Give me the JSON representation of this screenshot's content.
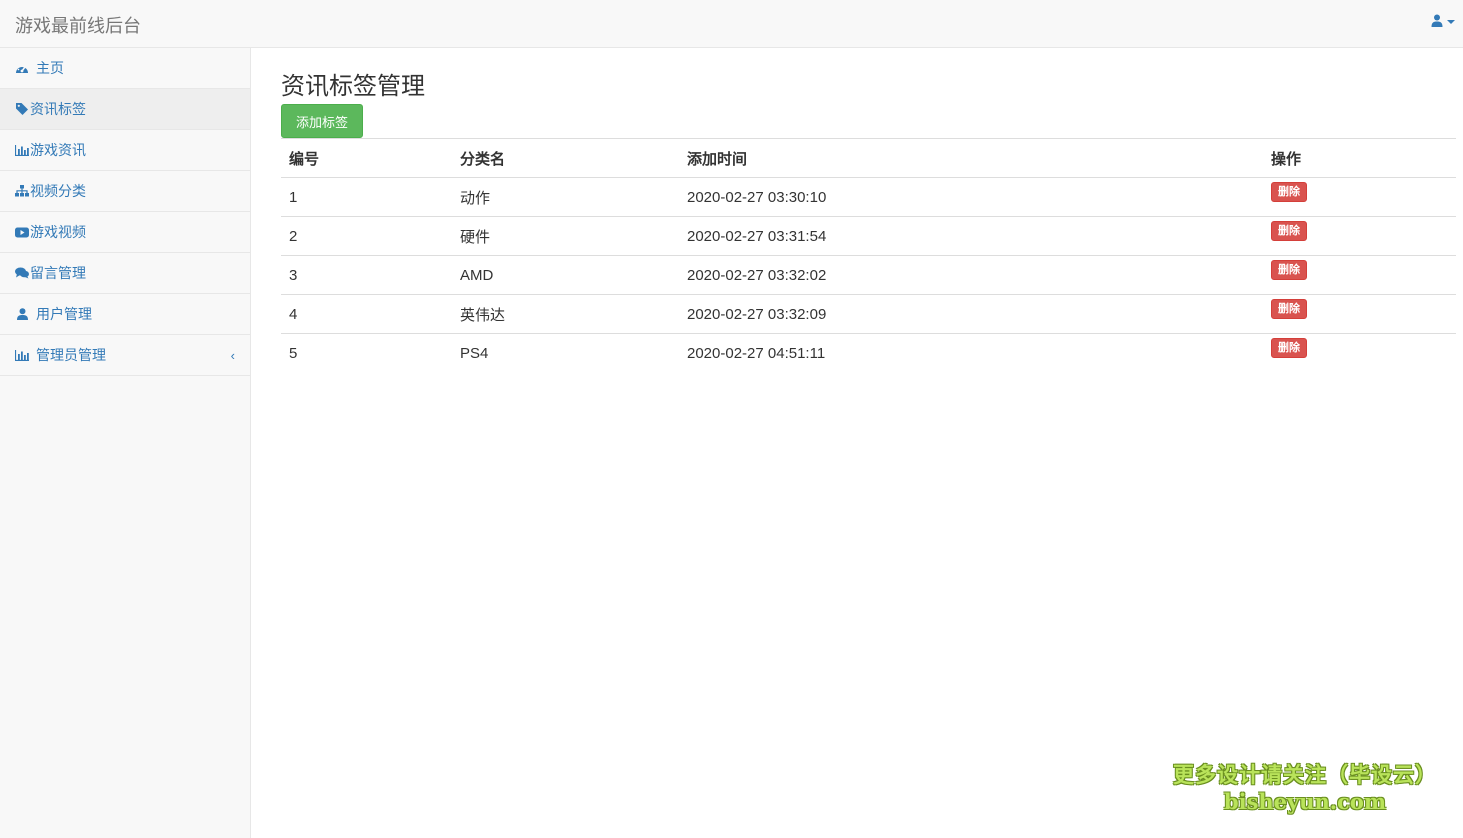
{
  "header": {
    "brand": "游戏最前线后台",
    "user_icon": "user-icon"
  },
  "sidebar": {
    "items": [
      {
        "label": "主页",
        "icon": "dashboard-icon"
      },
      {
        "label": "资讯标签",
        "icon": "tag-icon",
        "active": true
      },
      {
        "label": "游戏资讯",
        "icon": "bar-chart-icon"
      },
      {
        "label": "视频分类",
        "icon": "sitemap-icon"
      },
      {
        "label": "游戏视频",
        "icon": "youtube-play-icon"
      },
      {
        "label": "留言管理",
        "icon": "comments-icon"
      },
      {
        "label": "用户管理",
        "icon": "user-icon"
      },
      {
        "label": "管理员管理",
        "icon": "bar-chart-icon",
        "chevron": "‹"
      }
    ]
  },
  "main": {
    "title": "资讯标签管理",
    "add_button": "添加标签",
    "table": {
      "headers": [
        "编号",
        "分类名",
        "添加时间",
        "操作"
      ],
      "rows": [
        {
          "id": "1",
          "name": "动作",
          "time": "2020-02-27 03:30:10",
          "action": "删除"
        },
        {
          "id": "2",
          "name": "硬件",
          "time": "2020-02-27 03:31:54",
          "action": "删除"
        },
        {
          "id": "3",
          "name": "AMD",
          "time": "2020-02-27 03:32:02",
          "action": "删除"
        },
        {
          "id": "4",
          "name": "英伟达",
          "time": "2020-02-27 03:32:09",
          "action": "删除"
        },
        {
          "id": "5",
          "name": "PS4",
          "time": "2020-02-27 04:51:11",
          "action": "删除"
        }
      ]
    }
  },
  "watermark": {
    "line1": "更多设计请关注（毕设云）",
    "line2": "bisheyun.com"
  },
  "colors": {
    "link": "#337ab7",
    "success": "#5cb85c",
    "danger": "#d9534f",
    "watermark": "#b9e35a"
  }
}
